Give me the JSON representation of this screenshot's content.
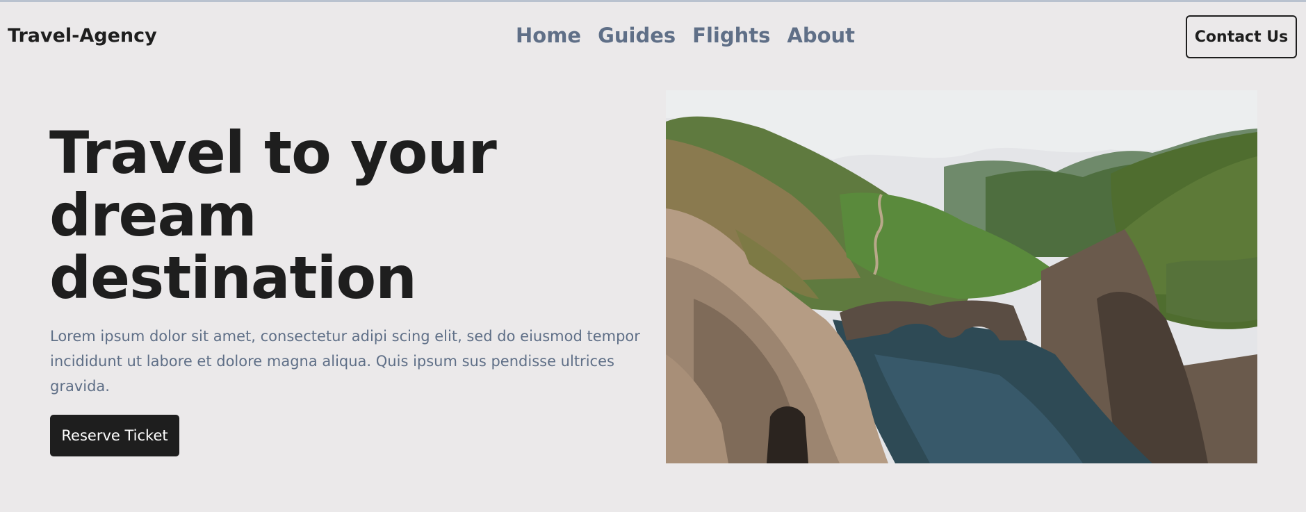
{
  "header": {
    "brand": "Travel-Agency",
    "nav": [
      {
        "label": "Home"
      },
      {
        "label": "Guides"
      },
      {
        "label": "Flights"
      },
      {
        "label": "About"
      }
    ],
    "cta_label": "Contact Us"
  },
  "hero": {
    "title": "Travel to your dream destination",
    "description": "Lorem ipsum dolor sit amet, consectetur adipi scing elit, sed do eiusmod tempor incididunt ut labore et dolore magna aliqua. Quis ipsum sus pendisse ultrices gravida.",
    "button_label": "Reserve Ticket"
  },
  "colors": {
    "background": "#ebe9ea",
    "text_dark": "#1e1e1e",
    "text_muted": "#5f6f87"
  }
}
